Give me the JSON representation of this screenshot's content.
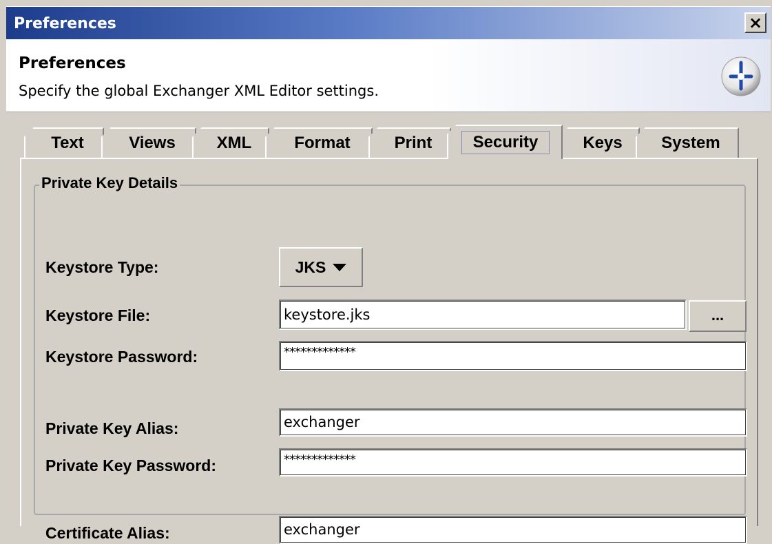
{
  "window": {
    "title": "Preferences",
    "close_label": "×"
  },
  "header": {
    "title": "Preferences",
    "description": "Specify the global Exchanger XML Editor settings.",
    "logo_icon": "exchanger-logo-icon"
  },
  "tabs": [
    {
      "label": "Text",
      "active": false
    },
    {
      "label": "Views",
      "active": false
    },
    {
      "label": "XML",
      "active": false
    },
    {
      "label": "Format",
      "active": false
    },
    {
      "label": "Print",
      "active": false
    },
    {
      "label": "Security",
      "active": true
    },
    {
      "label": "Keys",
      "active": false
    },
    {
      "label": "System",
      "active": false
    }
  ],
  "security": {
    "group_title": "Private Key Details",
    "keystore_type_label": "Keystore Type:",
    "keystore_type_value": "JKS",
    "keystore_file_label": "Keystore File:",
    "keystore_file_value": "keystore.jks",
    "browse_label": "...",
    "keystore_password_label": "Keystore Password:",
    "keystore_password_value": "*************",
    "private_key_alias_label": "Private Key Alias:",
    "private_key_alias_value": "exchanger",
    "private_key_password_label": "Private Key Password:",
    "private_key_password_value": "*************",
    "certificate_alias_label": "Certificate Alias:",
    "certificate_alias_value": "exchanger"
  },
  "colors": {
    "title_bar_dark": "#1c3c8c",
    "title_bar_light": "#c9d4ec",
    "panel_background": "#d4d0c8"
  }
}
